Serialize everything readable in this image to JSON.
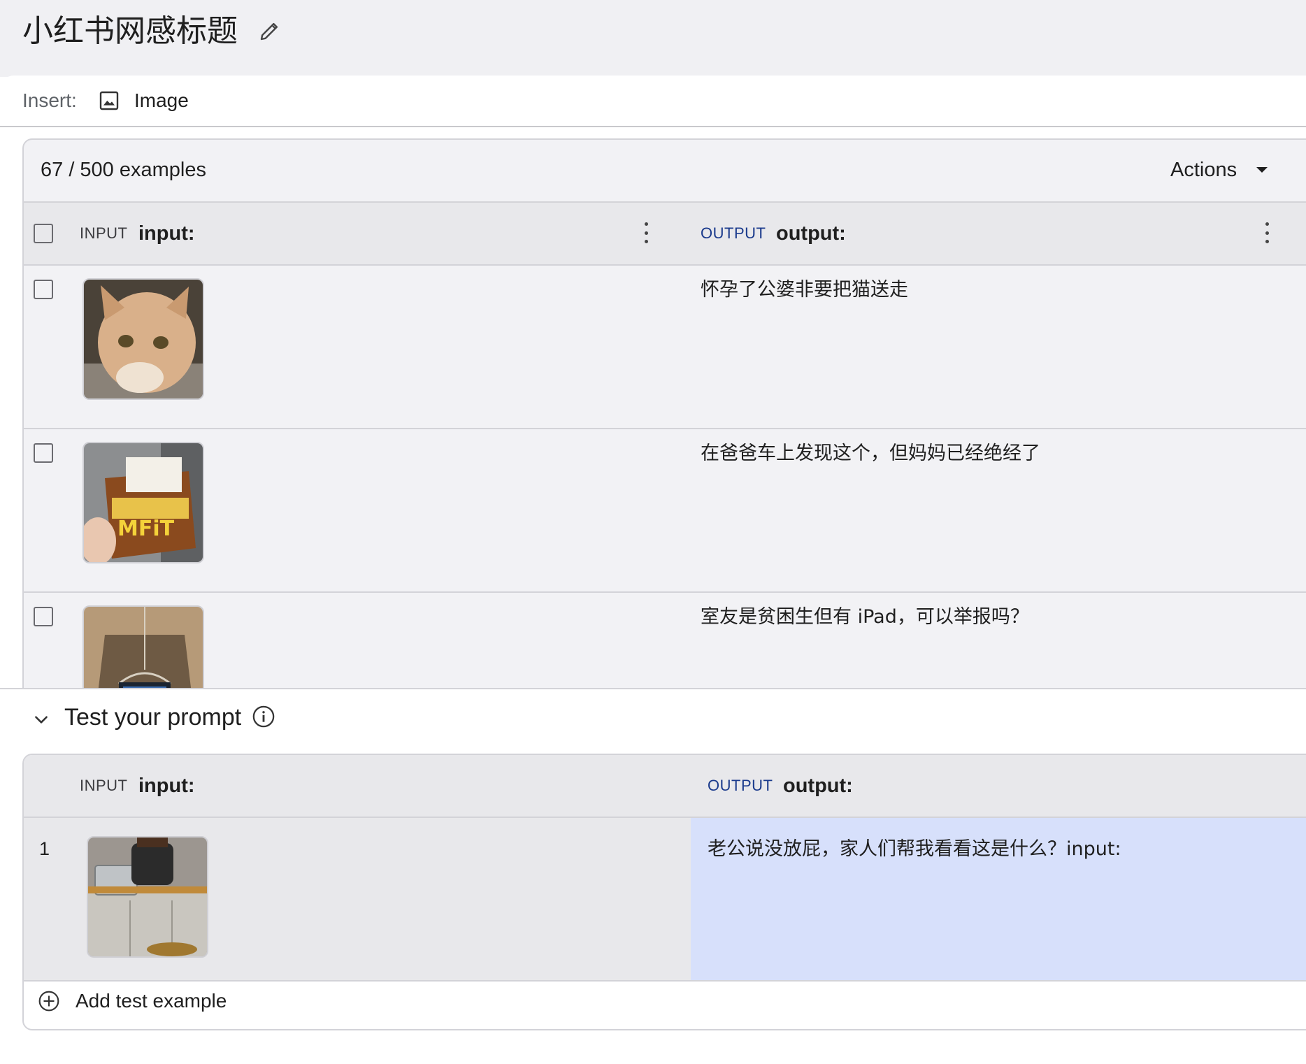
{
  "header": {
    "title": "小红书网感标题",
    "edit_icon": "pencil-icon"
  },
  "insert_bar": {
    "label": "Insert:",
    "image_button_label": "Image",
    "image_icon": "image-icon"
  },
  "examples": {
    "count_label": "67 / 500 examples",
    "actions_label": "Actions",
    "columns": {
      "input_tag": "INPUT",
      "input_field": "input:",
      "output_tag": "OUTPUT",
      "output_field": "output:"
    },
    "rows": [
      {
        "image": "orange tabby cat photo",
        "output": "怀孕了公婆非要把猫送走"
      },
      {
        "image": "hand holding snack packets photo",
        "output": "在爸爸车上发现这个，但妈妈已经绝经了"
      },
      {
        "image": "small room with hanging tablet photo",
        "output": "室友是贫困生但有 iPad，可以举报吗？"
      }
    ]
  },
  "test_prompt": {
    "title": "Test your prompt",
    "info_icon": "info-icon",
    "collapse_icon": "chevron-down-icon",
    "columns": {
      "input_tag": "INPUT",
      "input_field": "input:",
      "output_tag": "OUTPUT",
      "output_field": "output:"
    },
    "rows": [
      {
        "number": "1",
        "image": "kitchen sink with pressure cooker photo",
        "output": "老公说没放屁，家人们帮我看看这是什么？input:"
      }
    ],
    "add_example_label": "Add test example"
  },
  "colors": {
    "output_tag": "#1a3a8c",
    "test_output_highlight": "#d7e0fb",
    "panel_bg": "#f2f2f5",
    "header_bg": "#e8e8eb"
  }
}
